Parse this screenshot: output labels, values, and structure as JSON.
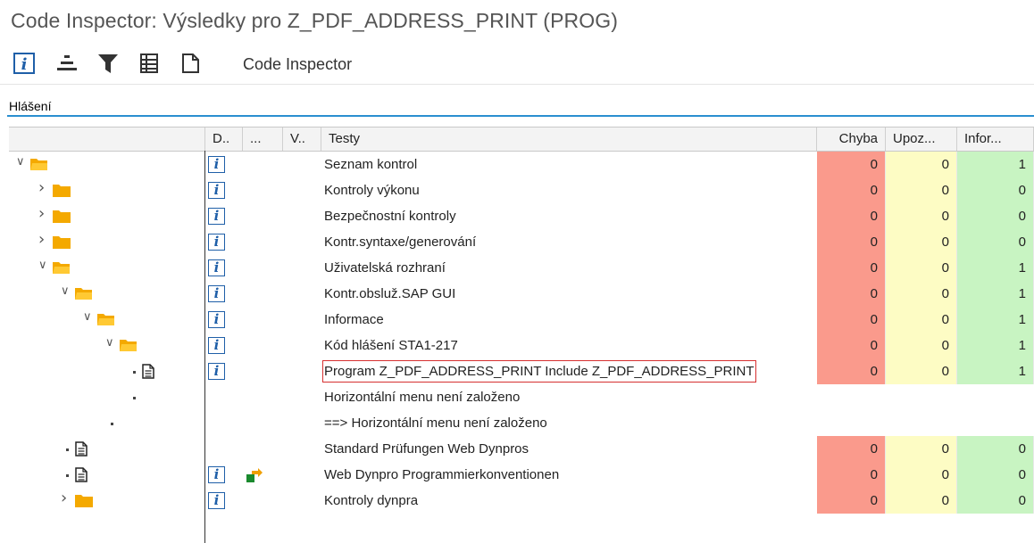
{
  "window": {
    "title": "Code Inspector: Výsledky pro Z_PDF_ADDRESS_PRINT (PROG)"
  },
  "toolbar": {
    "icons": [
      "info-icon",
      "sort-icon",
      "filter-icon",
      "list-icon",
      "document-icon"
    ],
    "label": "Code Inspector"
  },
  "section": {
    "label": "Hlášení"
  },
  "columns": {
    "tree": "",
    "d": "D..",
    "dots": "...",
    "v": "V..",
    "tests": "Testy",
    "error": "Chyba",
    "warning": "Upoz...",
    "info": "Infor..."
  },
  "colors": {
    "error": "#fa9a8c",
    "warning": "#fdfcc4",
    "info": "#c8f4c2",
    "folder": "#f4a900",
    "accent": "#2a8fd0"
  },
  "rows": [
    {
      "text": "Seznam kontrol",
      "level": 0,
      "node": "folder-open",
      "info": true,
      "chyba": "0",
      "upoz": "0",
      "infor": "1"
    },
    {
      "text": "Kontroly výkonu",
      "level": 1,
      "node": "folder-closed",
      "info": true,
      "chyba": "0",
      "upoz": "0",
      "infor": "0"
    },
    {
      "text": "Bezpečnostní kontroly",
      "level": 1,
      "node": "folder-closed",
      "info": true,
      "chyba": "0",
      "upoz": "0",
      "infor": "0"
    },
    {
      "text": "Kontr.syntaxe/generování",
      "level": 1,
      "node": "folder-closed",
      "info": true,
      "chyba": "0",
      "upoz": "0",
      "infor": "0"
    },
    {
      "text": "Uživatelská rozhraní",
      "level": 1,
      "node": "folder-open",
      "info": true,
      "chyba": "0",
      "upoz": "0",
      "infor": "1"
    },
    {
      "text": "Kontr.obsluž.SAP GUI",
      "level": 2,
      "node": "folder-open",
      "info": true,
      "chyba": "0",
      "upoz": "0",
      "infor": "1"
    },
    {
      "text": "Informace",
      "level": 3,
      "node": "folder-open",
      "info": true,
      "chyba": "0",
      "upoz": "0",
      "infor": "1"
    },
    {
      "text": "Kód hlášení STA1-217",
      "level": 4,
      "node": "folder-open",
      "info": true,
      "chyba": "0",
      "upoz": "0",
      "infor": "1"
    },
    {
      "text": "Program Z_PDF_ADDRESS_PRINT Include Z_PDF_ADDRESS_PRINT",
      "level": 5,
      "node": "doc",
      "info": true,
      "chyba": "0",
      "upoz": "0",
      "infor": "1",
      "selected": true
    },
    {
      "text": "Horizontální menu není založeno",
      "level": 5,
      "node": "dot",
      "info": false,
      "chyba": "",
      "upoz": "",
      "infor": ""
    },
    {
      "text": "==> Horizontální menu není založeno",
      "level": 4,
      "node": "dot",
      "info": false,
      "chyba": "",
      "upoz": "",
      "infor": ""
    },
    {
      "text": "Standard Prüfungen Web Dynpros",
      "level": 2,
      "node": "doc",
      "info": false,
      "chyba": "0",
      "upoz": "0",
      "infor": "0"
    },
    {
      "text": "Web Dynpro Programmierkonventionen",
      "level": 2,
      "node": "doc",
      "info": true,
      "action": true,
      "chyba": "0",
      "upoz": "0",
      "infor": "0"
    },
    {
      "text": "Kontroly dynpra",
      "level": 2,
      "node": "folder-closed",
      "info": true,
      "chyba": "0",
      "upoz": "0",
      "infor": "0"
    }
  ]
}
